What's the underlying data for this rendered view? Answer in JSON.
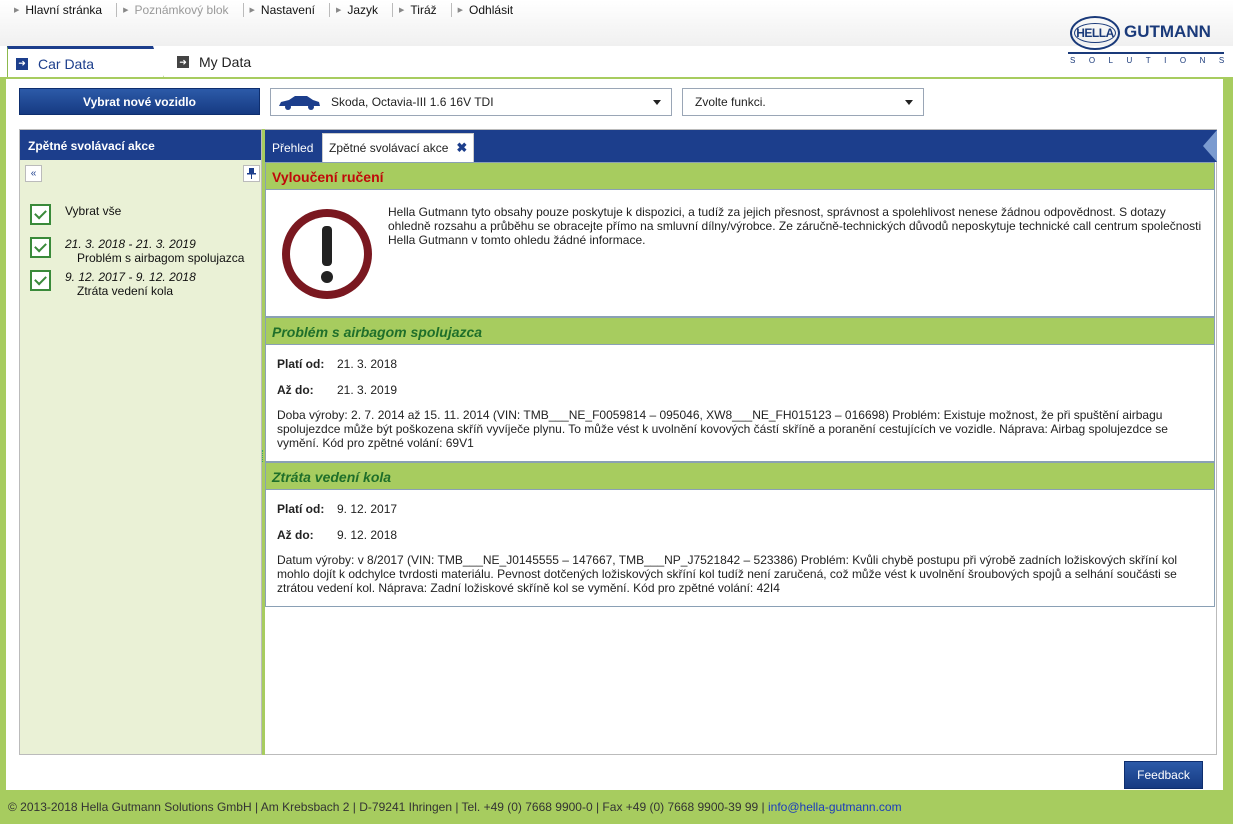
{
  "nav": {
    "items": [
      {
        "label": "Hlavní stránka",
        "disabled": false
      },
      {
        "label": "Poznámkový blok",
        "disabled": true
      },
      {
        "label": "Nastavení",
        "disabled": false
      },
      {
        "label": "Jazyk",
        "disabled": false
      },
      {
        "label": "Tiráž",
        "disabled": false
      },
      {
        "label": "Odhlásit",
        "disabled": false
      }
    ]
  },
  "logo": {
    "oval": "HELLA",
    "brand": "GUTMANN",
    "sub": "SOLUTIONS"
  },
  "tabs": {
    "car_data": "Car Data",
    "my_data": "My Data"
  },
  "toolbar": {
    "new_vehicle": "Vybrat nové vozidlo",
    "vehicle": "Skoda, Octavia-III 1.6 16V TDI",
    "function_placeholder": "Zvolte funkci."
  },
  "left_panel": {
    "title": "Zpětné svolávací akce",
    "collapse_icon": "«",
    "pin_icon": "📌",
    "select_all": "Vybrat vše",
    "items": [
      {
        "dates": "21. 3. 2018 - 21. 3. 2019",
        "label": "Problém s airbagom spolujazca"
      },
      {
        "dates": "9. 12. 2017 - 9. 12. 2018",
        "label": "Ztráta vedení kola"
      }
    ]
  },
  "right_tabs": {
    "overview": "Přehled",
    "recalls": "Zpětné svolávací akce",
    "close": "✖"
  },
  "disclaimer": {
    "title": "Vyloučení ručení",
    "text": "Hella Gutmann tyto obsahy pouze poskytuje k dispozici, a tudíž za jejich přesnost, správnost a spolehlivost nenese žádnou odpovědnost. S dotazy ohledně rozsahu a průběhu se obracejte přímo na smluvní dílny/výrobce. Ze záručně-technických důvodů neposkytuje technické call centrum společnosti Hella Gutmann v tomto ohledu žádné informace."
  },
  "labels": {
    "valid_from": "Platí od:",
    "valid_to": "Až do:"
  },
  "recalls": [
    {
      "title": "Problém s airbagom spolujazca",
      "from": "21. 3. 2018",
      "to": "21. 3. 2019",
      "description": "Doba výroby: 2. 7. 2014 až 15. 11. 2014 (VIN: TMB___NE_F0059814 – 095046, XW8___NE_FH015123 – 016698) Problém: Existuje možnost, že při spuštění airbagu spolujezdce může být poškozena skříň vyvíječe plynu. To může vést k uvolnění kovových částí skříně a poranění cestujících ve vozidle. Náprava: Airbag spolujezdce se vymění. Kód pro zpětné volání: 69V1"
    },
    {
      "title": "Ztráta vedení kola",
      "from": "9. 12. 2017",
      "to": "9. 12. 2018",
      "description": "Datum výroby: v 8/2017 (VIN: TMB___NE_J0145555 – 147667, TMB___NP_J7521842 – 523386) Problém: Kvůli chybě postupu při výrobě zadních ložiskových skříní kol mohlo dojít k odchylce tvrdosti materiálu. Pevnost dotčených ložiskových skříní kol tudíž není zaručená, což může vést k uvolnění šroubových spojů a selhání součásti se ztrátou vedení kol. Náprava: Zadní ložiskové skříně kol se vymění. Kód pro zpětné volání: 42I4"
    }
  ],
  "feedback": "Feedback",
  "footer": {
    "text": "© 2013-2018 Hella Gutmann Solutions GmbH | Am Krebsbach 2 | D-79241 Ihringen | Tel. +49 (0) 7668 9900-0 | Fax +49 (0) 7668 9900-39 99 | ",
    "email": "info@hella-gutmann.com"
  },
  "colors": {
    "brand_blue": "#1c3e8c",
    "accent_green": "#a7cc5f",
    "alert_red": "#c0080a"
  }
}
